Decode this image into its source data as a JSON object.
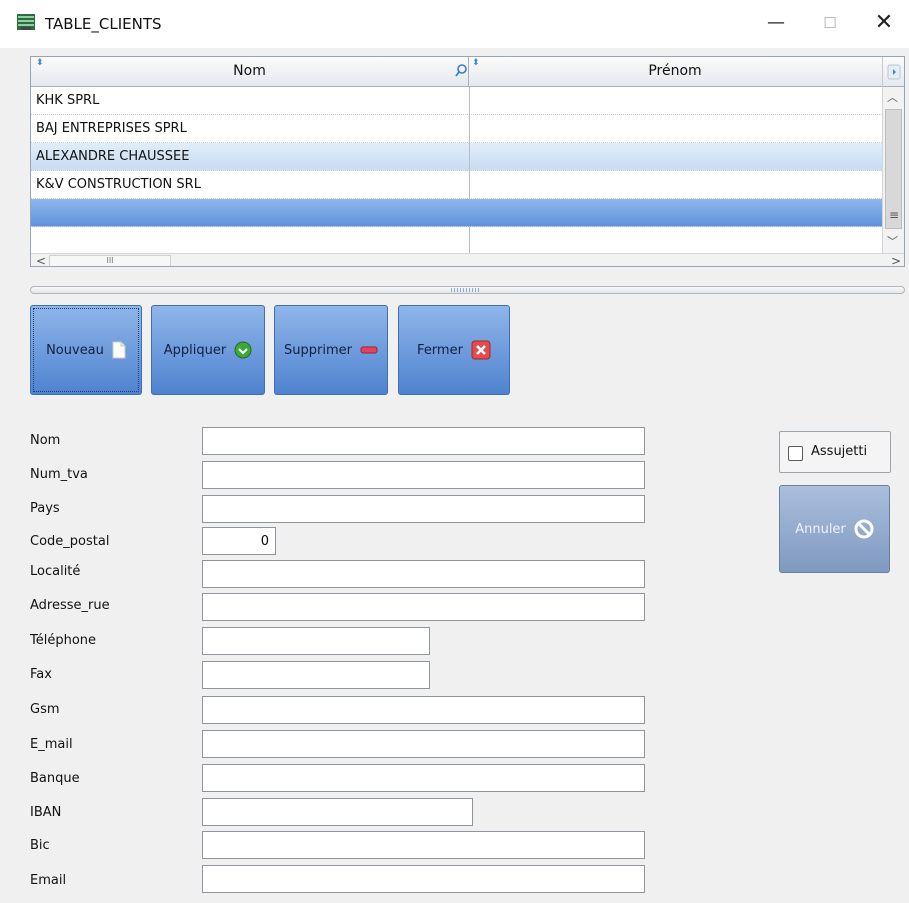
{
  "window": {
    "title": "TABLE_CLIENTS",
    "minimize_glyph": "—",
    "maximize_glyph": "☐",
    "close_glyph": "✕"
  },
  "table": {
    "columns": [
      "Nom",
      "Prénom"
    ],
    "sort_glyph": "⬍",
    "rows": [
      {
        "nom": "KHK SPRL",
        "prenom": ""
      },
      {
        "nom": "BAJ ENTREPRISES SPRL",
        "prenom": ""
      },
      {
        "nom": "ALEXANDRE CHAUSSEE",
        "prenom": ""
      },
      {
        "nom": "K&V CONSTRUCTION SRL",
        "prenom": ""
      },
      {
        "nom": "",
        "prenom": ""
      },
      {
        "nom": "",
        "prenom": ""
      }
    ],
    "scroll": {
      "up": "︿",
      "down": "﹀",
      "grip": "≡",
      "left": "<",
      "right": ">",
      "thumb_grip": "III"
    }
  },
  "actions": {
    "nouveau": "Nouveau",
    "appliquer": "Appliquer",
    "supprimer": "Supprimer",
    "fermer": "Fermer"
  },
  "form": {
    "labels": {
      "nom": "Nom",
      "num_tva": "Num_tva",
      "pays": "Pays",
      "code_postal": "Code_postal",
      "localite": "Localité",
      "adresse_rue": "Adresse_rue",
      "telephone": "Téléphone",
      "fax": "Fax",
      "gsm": "Gsm",
      "e_mail": "E_mail",
      "banque": "Banque",
      "iban": "IBAN",
      "bic": "Bic",
      "email": "Email"
    },
    "values": {
      "nom": "",
      "num_tva": "",
      "pays": "",
      "code_postal": "0",
      "localite": "",
      "adresse_rue": "",
      "telephone": "",
      "fax": "",
      "gsm": "",
      "e_mail": "",
      "banque": "",
      "iban": "",
      "bic": "",
      "email": ""
    },
    "assujetti_label": "Assujetti",
    "assujetti_checked": false,
    "annuler": "Annuler"
  },
  "colors": {
    "button_blue": "#4f82cf",
    "row_highlight": "#c6dcf2",
    "row_selected": "#5f92dd"
  },
  "icons": [
    "app-table-icon",
    "search-icon",
    "document-icon",
    "green-check-circle-icon",
    "red-minus-icon",
    "red-x-icon",
    "no-entry-icon"
  ]
}
